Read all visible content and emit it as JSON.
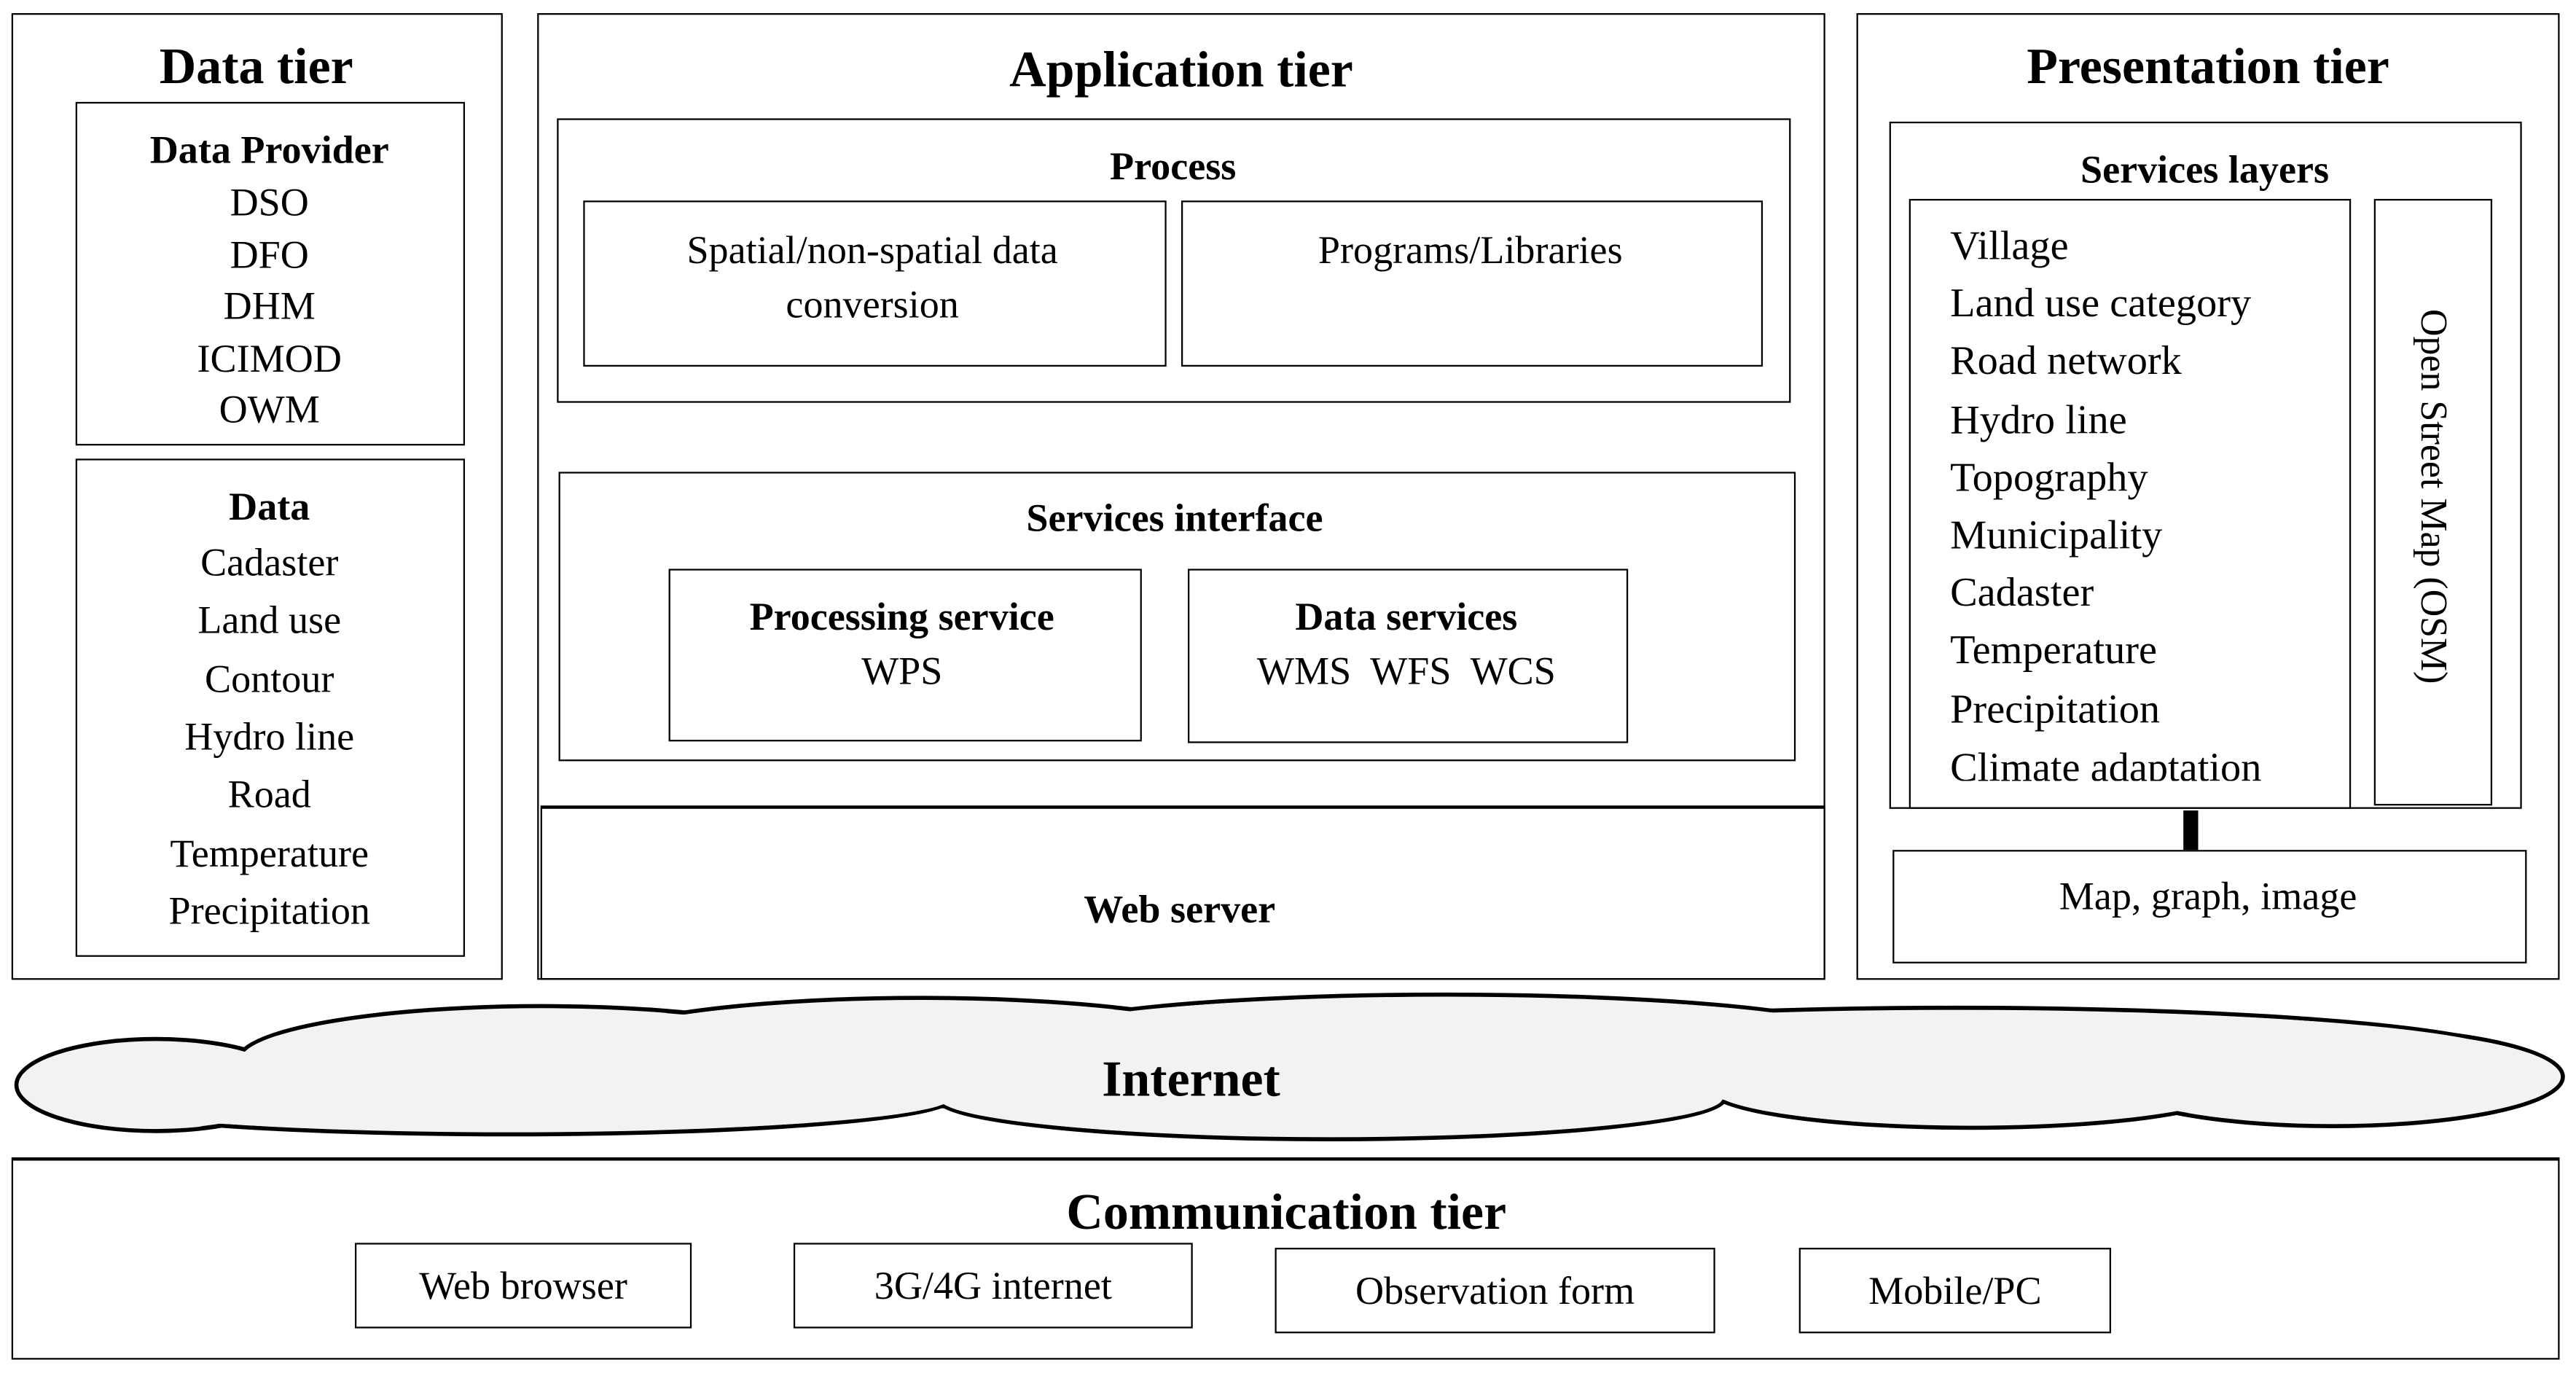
{
  "data_tier": {
    "title": "Data tier",
    "provider": {
      "title": "Data Provider",
      "items": [
        "DSO",
        "DFO",
        "DHM",
        "ICIMOD",
        "OWM"
      ]
    },
    "data": {
      "title": "Data",
      "items": [
        "Cadaster",
        "Land use",
        "Contour",
        "Hydro line",
        "Road",
        "Temperature",
        "Precipitation"
      ]
    }
  },
  "application_tier": {
    "title": "Application tier",
    "process": {
      "title": "Process",
      "conversion_line1": "Spatial/non-spatial data",
      "conversion_line2": "conversion",
      "programs": "Programs/Libraries"
    },
    "services_interface": {
      "title": "Services interface",
      "processing": {
        "title": "Processing service",
        "body": "WPS"
      },
      "data_services": {
        "title": "Data services",
        "body": "WMS  WFS  WCS"
      }
    },
    "web_server": "Web server"
  },
  "presentation_tier": {
    "title": "Presentation tier",
    "services_layers": {
      "title": "Services layers",
      "items": [
        "Village",
        "Land use category",
        "Road network",
        "Hydro line",
        "Topography",
        "Municipality",
        "Cadaster",
        "Temperature",
        "Precipitation",
        "Climate adaptation"
      ],
      "osm": "Open Street Map (OSM)"
    },
    "output": "Map, graph, image"
  },
  "internet": {
    "label": "Internet",
    "fill": "#f2f2f2"
  },
  "communication_tier": {
    "title": "Communication tier",
    "items": [
      "Web browser",
      "3G/4G internet",
      "Observation form",
      "Mobile/PC"
    ]
  }
}
